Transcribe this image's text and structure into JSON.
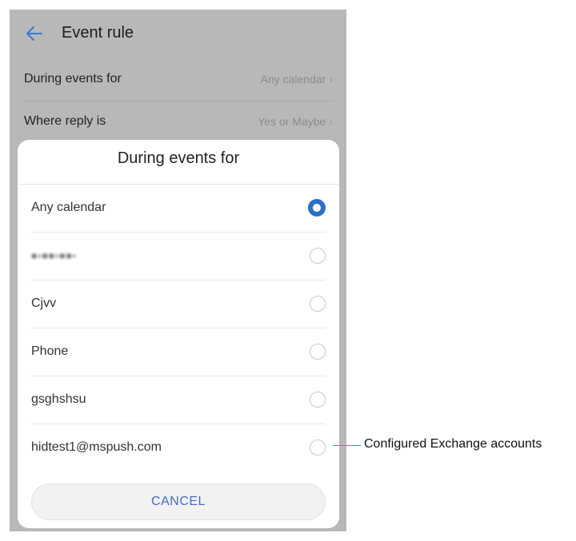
{
  "appbar": {
    "title": "Event rule",
    "back_icon": "arrow-left-icon"
  },
  "settings": [
    {
      "label": "During events for",
      "value": "Any calendar"
    },
    {
      "label": "Where reply is",
      "value": "Yes or Maybe"
    }
  ],
  "dialog": {
    "title": "During events for",
    "options": [
      {
        "label": "Any calendar",
        "selected": true
      },
      {
        "label": "",
        "selected": false,
        "blurred": true
      },
      {
        "label": "Cjvv",
        "selected": false
      },
      {
        "label": "Phone",
        "selected": false
      },
      {
        "label": "gsghshsu",
        "selected": false
      },
      {
        "label": "hidtest1@mspush.com",
        "selected": false
      }
    ],
    "cancel_label": "CANCEL"
  },
  "annotation": {
    "text": "Configured Exchange accounts"
  },
  "colors": {
    "accent": "#2a6fc9",
    "callout": "#2aa9a9",
    "scrim": "#b8b8b8"
  }
}
